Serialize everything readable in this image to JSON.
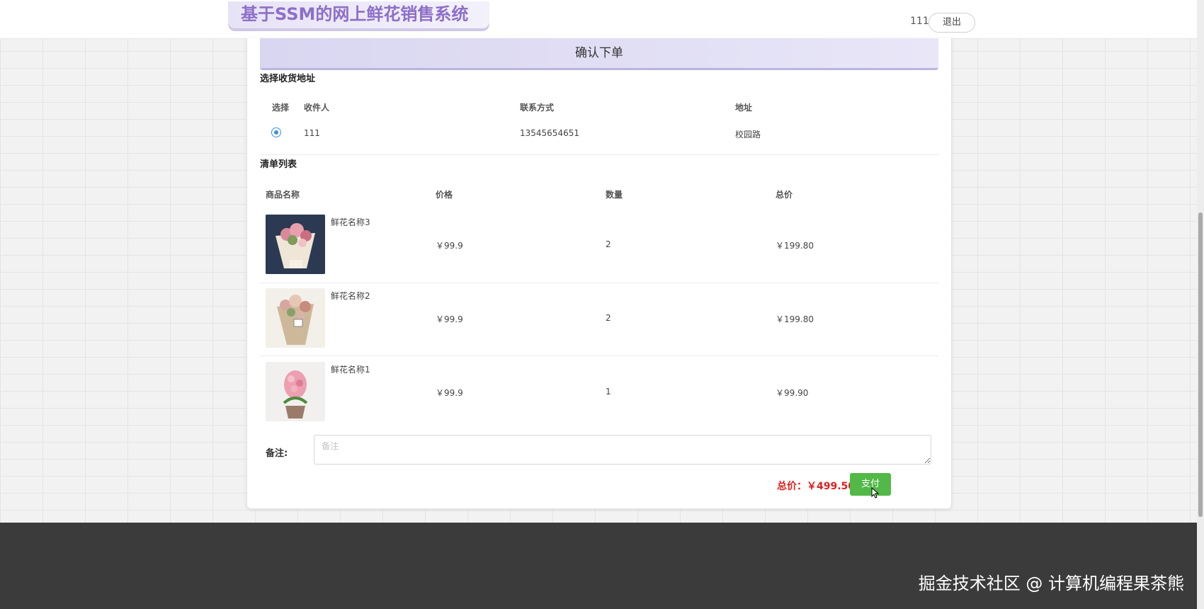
{
  "header": {
    "site_title": "基于SSM的网上鲜花销售系统",
    "user_name": "111",
    "logout_label": "退出"
  },
  "page": {
    "title": "确认下单"
  },
  "address_section": {
    "title": "选择收货地址",
    "columns": [
      "选择",
      "收件人",
      "联系方式",
      "地址"
    ],
    "rows": [
      {
        "selected": true,
        "recipient": "111",
        "phone": "13545654651",
        "address": "校园路"
      }
    ]
  },
  "items_section": {
    "title": "清单列表",
    "columns": [
      "商品名称",
      "价格",
      "数量",
      "总价"
    ],
    "rows": [
      {
        "name": "鲜花名称3",
        "price": "￥99.9",
        "quantity": "2",
        "subtotal": "￥199.80",
        "image_icon": "flower-bouquet-image"
      },
      {
        "name": "鲜花名称2",
        "price": "￥99.9",
        "quantity": "2",
        "subtotal": "￥199.80",
        "image_icon": "flower-bouquet-image"
      },
      {
        "name": "鲜花名称1",
        "price": "￥99.9",
        "quantity": "1",
        "subtotal": "￥99.90",
        "image_icon": "potted-flower-image"
      }
    ]
  },
  "remark": {
    "label": "备注:",
    "placeholder": "备注",
    "value": ""
  },
  "summary": {
    "total_label": "总价：￥499.50",
    "pay_label": "支付"
  },
  "footer": {
    "watermark": "掘金技术社区 @ 计算机编程果茶熊"
  },
  "colors": {
    "title_purple": "#8d6fc8",
    "total_red": "#e02020",
    "pay_green": "#52b847",
    "radio_blue": "#3c8fe0",
    "footer_dark": "#3b3b3b"
  }
}
